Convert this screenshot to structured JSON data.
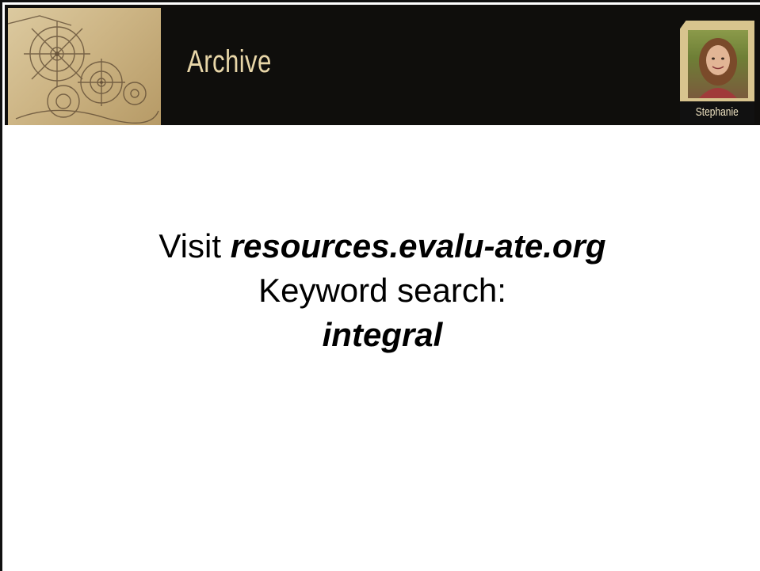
{
  "header": {
    "title": "Archive",
    "presenter": {
      "name": "Stephanie",
      "photo_icon": "presenter-photo"
    },
    "decoration_icon": "gear-sketch-illustration"
  },
  "content": {
    "line1_prefix": "Visit ",
    "line1_link": "resources.evalu-ate.org",
    "line2": "Keyword search:",
    "line3": "integral"
  },
  "colors": {
    "header_bg": "#0f0e0c",
    "title_text": "#e8d6a8",
    "badge_frame": "#d8c48e"
  }
}
